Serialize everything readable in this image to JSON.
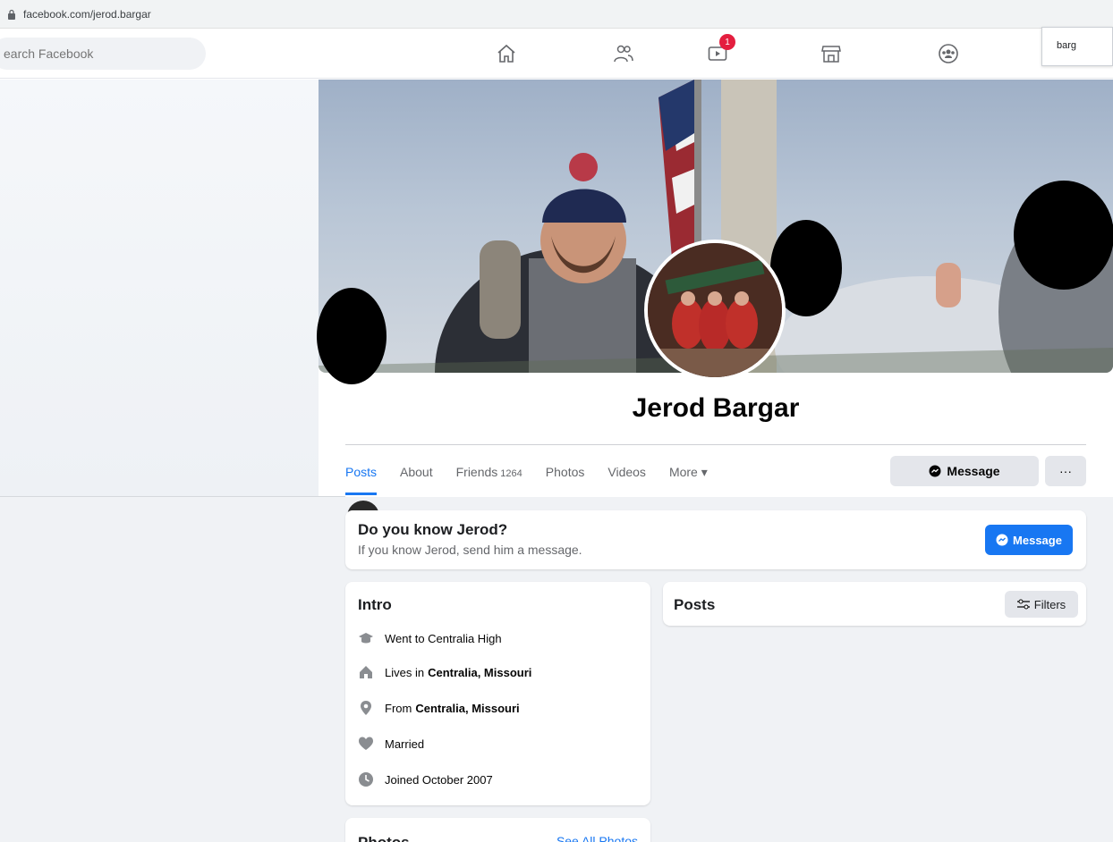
{
  "browser": {
    "url": "facebook.com/jerod.bargar"
  },
  "topnav": {
    "search_placeholder": "earch Facebook",
    "icons": [
      "home-icon",
      "friends-icon",
      "watch-icon",
      "marketplace-icon",
      "groups-icon"
    ],
    "watch_badge": "1",
    "account_text": "barg"
  },
  "profile": {
    "name": "Jerod Bargar"
  },
  "tabs": {
    "posts": "Posts",
    "about": "About",
    "friends": "Friends",
    "friends_count": "1264",
    "photos": "Photos",
    "videos": "Videos",
    "more": "More ▾"
  },
  "actions": {
    "message": "Message",
    "more": "···"
  },
  "know_card": {
    "title": "Do you know Jerod?",
    "subtitle": "If you know Jerod, send him a message.",
    "button": "Message"
  },
  "intro": {
    "title": "Intro",
    "school": "Went to Centralia High",
    "lives_prefix": "Lives in",
    "lives_place": "Centralia, Missouri",
    "from_prefix": "From",
    "from_place": "Centralia, Missouri",
    "relationship": "Married",
    "joined": "Joined October 2007"
  },
  "posts_card": {
    "title": "Posts",
    "filters": "Filters"
  },
  "photos_card": {
    "title": "Photos",
    "see_all": "See All Photos"
  },
  "colors": {
    "accent": "#1877f2",
    "badge": "#e41e3f",
    "feed_bg": "#f0f2f5"
  }
}
